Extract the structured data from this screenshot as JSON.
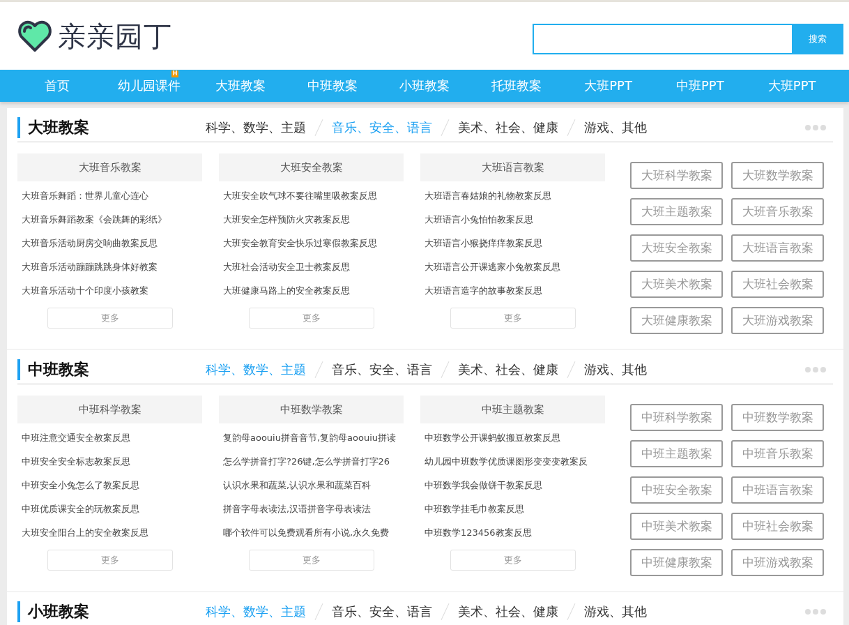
{
  "logo": {
    "text": "亲亲园丁"
  },
  "search": {
    "button": "搜索"
  },
  "nav": [
    {
      "label": "首页"
    },
    {
      "label": "幼儿园课件",
      "badge": "H"
    },
    {
      "label": "大班教案"
    },
    {
      "label": "中班教案"
    },
    {
      "label": "小班教案"
    },
    {
      "label": "托班教案"
    },
    {
      "label": "大班PPT"
    },
    {
      "label": "中班PPT"
    },
    {
      "label": "大班PPT"
    }
  ],
  "sections": [
    {
      "title": "大班教案",
      "tabs": [
        {
          "label": "科学、数学、主题",
          "selected": false
        },
        {
          "label": "音乐、安全、语言",
          "selected": true
        },
        {
          "label": "美术、社会、健康",
          "selected": false
        },
        {
          "label": "游戏、其他",
          "selected": false
        }
      ],
      "columns": [
        {
          "heading": "大班音乐教案",
          "items": [
            "大班音乐舞蹈：世界儿童心连心",
            "大班音乐舞蹈教案《会跳舞的彩纸》",
            "大班音乐活动厨房交响曲教案反思",
            "大班音乐活动蹦蹦跳跳身体好教案",
            "大班音乐活动十个印度小孩教案"
          ],
          "more": "更多"
        },
        {
          "heading": "大班安全教案",
          "items": [
            "大班安全吹气球不要往嘴里吸教案反思",
            "大班安全怎样预防火灾教案反思",
            "大班安全教育安全快乐过寒假教案反思",
            "大班社会活动安全卫士教案反思",
            "大班健康马路上的安全教案反思"
          ],
          "more": "更多"
        },
        {
          "heading": "大班语言教案",
          "items": [
            "大班语言春姑娘的礼物教案反思",
            "大班语言小兔怕怕教案反思",
            "大班语言小猴挠痒痒教案反思",
            "大班语言公开课逃家小兔教案反思",
            "大班语言造字的故事教案反思"
          ],
          "more": "更多"
        }
      ],
      "tags": [
        "大班科学教案",
        "大班数学教案",
        "大班主题教案",
        "大班音乐教案",
        "大班安全教案",
        "大班语言教案",
        "大班美术教案",
        "大班社会教案",
        "大班健康教案",
        "大班游戏教案"
      ]
    },
    {
      "title": "中班教案",
      "tabs": [
        {
          "label": "科学、数学、主题",
          "selected": true
        },
        {
          "label": "音乐、安全、语言",
          "selected": false
        },
        {
          "label": "美术、社会、健康",
          "selected": false
        },
        {
          "label": "游戏、其他",
          "selected": false
        }
      ],
      "columns": [
        {
          "heading": "中班科学教案",
          "items": [
            "中班注意交通安全教案反思",
            "中班安全安全标志教案反思",
            "中班安全小兔怎么了教案反思",
            "中班优质课安全的玩教案反思",
            "大班安全阳台上的安全教案反思"
          ],
          "more": "更多"
        },
        {
          "heading": "中班数学教案",
          "items": [
            "复韵母aoouiu拼音音节,复韵母aoouiu拼读",
            "怎么学拼音打字?26键,怎么学拼音打字26",
            "认识水果和蔬菜,认识水果和蔬菜百科",
            "拼音字母表读法,汉语拼音字母表读法",
            "哪个软件可以免费观看所有小说,永久免费"
          ],
          "more": "更多"
        },
        {
          "heading": "中班主题教案",
          "items": [
            "中班数学公开课蚂蚁搬豆教案反思",
            "幼儿园中班数学优质课图形变变变教案反",
            "中班数学我会做饼干教案反思",
            "中班数学挂毛巾教案反思",
            "中班数学123456教案反思"
          ],
          "more": "更多"
        }
      ],
      "tags": [
        "中班科学教案",
        "中班数学教案",
        "中班主题教案",
        "中班音乐教案",
        "中班安全教案",
        "中班语言教案",
        "中班美术教案",
        "中班社会教案",
        "中班健康教案",
        "中班游戏教案"
      ]
    },
    {
      "title": "小班教案",
      "tabs": [
        {
          "label": "科学、数学、主题",
          "selected": true
        },
        {
          "label": "音乐、安全、语言",
          "selected": false
        },
        {
          "label": "美术、社会、健康",
          "selected": false
        },
        {
          "label": "游戏、其他",
          "selected": false
        }
      ]
    }
  ]
}
